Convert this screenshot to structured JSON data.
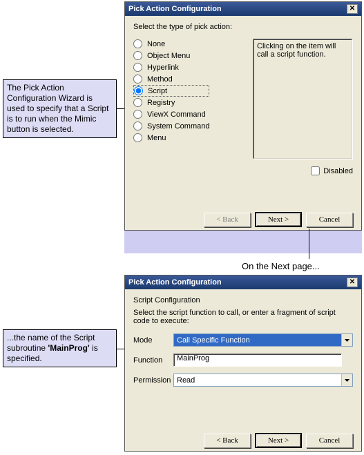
{
  "callout1": "The Pick Action Configuration Wizard is used to specify that a Script is to run when the Mimic button is selected.",
  "callout2_pre": "...the name of the Script subroutine ",
  "callout2_bold": "'MainProg'",
  "callout2_post": " is specified.",
  "next_page_label": "On the Next page...",
  "dialog1": {
    "title": "Pick Action Configuration",
    "prompt": "Select the type of pick action:",
    "options": [
      "None",
      "Object Menu",
      "Hyperlink",
      "Method",
      "Script",
      "Registry",
      "ViewX Command",
      "System Command",
      "Menu"
    ],
    "selected_index": 4,
    "description": "Clicking on the item will call a script function.",
    "disabled_label": "Disabled",
    "disabled_checked": false,
    "btn_back": "< Back",
    "btn_next": "Next >",
    "btn_cancel": "Cancel"
  },
  "dialog2": {
    "title": "Pick Action Configuration",
    "heading": "Script Configuration",
    "prompt": "Select the script function to call, or enter a fragment of script code to execute:",
    "mode_label": "Mode",
    "mode_value": "Call Specific Function",
    "function_label": "Function",
    "function_value": "MainProg",
    "permission_label": "Permission",
    "permission_value": "Read",
    "btn_back": "< Back",
    "btn_next": "Next >",
    "btn_cancel": "Cancel"
  }
}
